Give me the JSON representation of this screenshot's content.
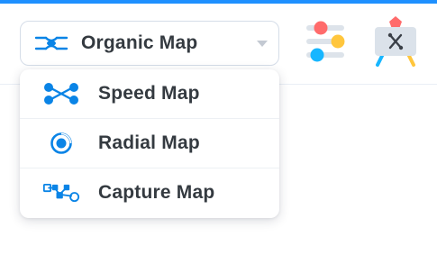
{
  "map_selector": {
    "selected_label": "Organic Map",
    "selected_icon": "organic-map-icon"
  },
  "menu": {
    "items": [
      {
        "label": "Speed Map",
        "icon": "speed-map-icon"
      },
      {
        "label": "Radial Map",
        "icon": "radial-map-icon"
      },
      {
        "label": "Capture Map",
        "icon": "capture-map-icon"
      }
    ]
  },
  "toolbar": {
    "tools": [
      {
        "icon": "sliders-icon"
      },
      {
        "icon": "paint-canvas-icon"
      }
    ]
  },
  "colors": {
    "accent": "#1e90ff",
    "icon_blue": "#0a84e6",
    "text": "#343a40",
    "slider_red": "#ff6b6b",
    "slider_yellow": "#ffc63d",
    "slider_blue": "#17b6ff"
  }
}
